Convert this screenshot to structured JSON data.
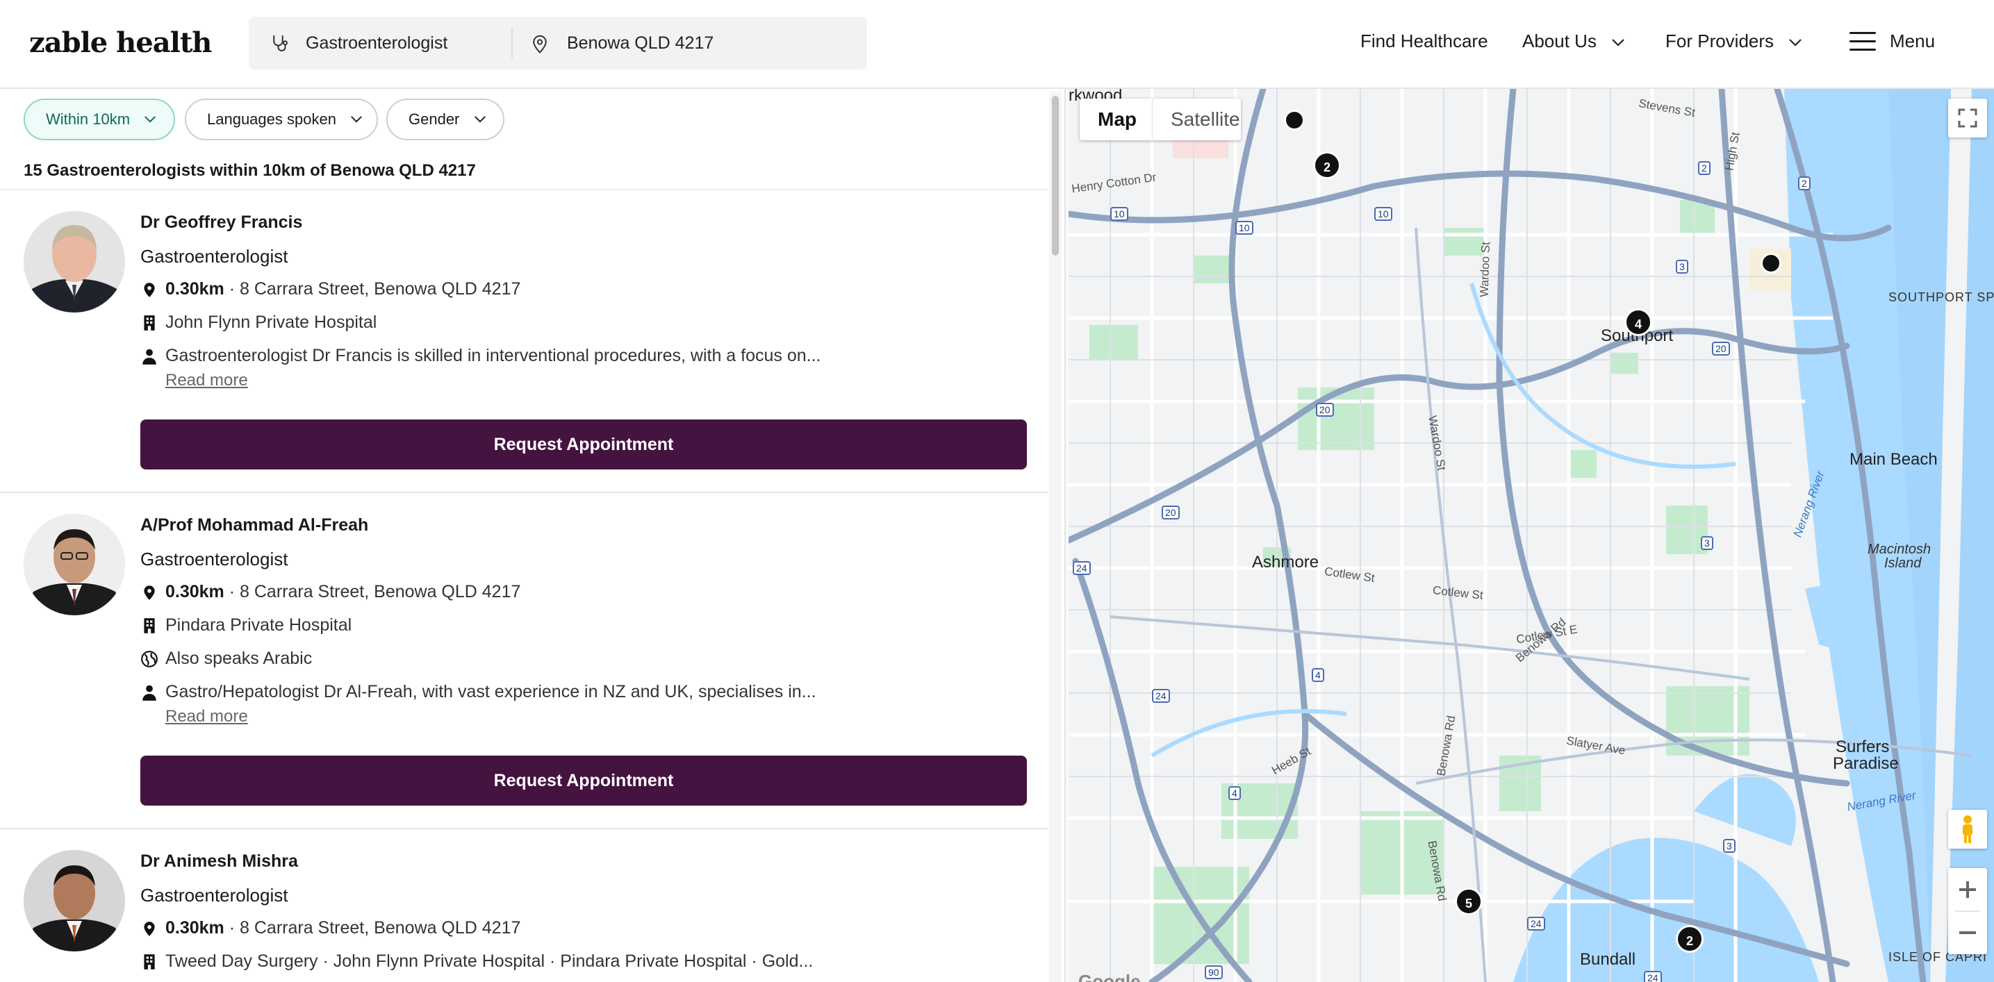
{
  "header": {
    "logo": "zable health",
    "search": {
      "specialty": "Gastroenterologist",
      "location": "Benowa QLD 4217"
    },
    "nav": {
      "find": "Find Healthcare",
      "about": "About Us",
      "providers": "For Providers",
      "menu": "Menu"
    }
  },
  "filters": [
    "Within 10km",
    "Languages spoken",
    "Gender"
  ],
  "results_count": "15 Gastroenterologists within 10km of Benowa QLD 4217",
  "doctors": [
    {
      "name": "Dr Geoffrey Francis",
      "specialty": "Gastroenterologist",
      "distance": "0.30km",
      "address": " · 8 Carrara Street, Benowa QLD 4217",
      "hospital": "John Flynn Private Hospital",
      "bio": "Gastroenterologist Dr Francis is skilled in interventional procedures, with a focus on...",
      "read_more": "Read more",
      "button": "Request Appointment"
    },
    {
      "name": "A/Prof Mohammad Al-Freah",
      "specialty": "Gastroenterologist",
      "distance": "0.30km",
      "address": " · 8 Carrara Street, Benowa QLD 4217",
      "hospital": "Pindara Private Hospital",
      "languages": "Also speaks Arabic",
      "bio": "Gastro/Hepatologist Dr Al-Freah, with vast experience in NZ and UK, specialises in...",
      "read_more": "Read more",
      "button": "Request Appointment"
    },
    {
      "name": "Dr Animesh Mishra",
      "specialty": "Gastroenterologist",
      "distance": "0.30km",
      "address": " · 8 Carrara Street, Benowa QLD 4217",
      "hospital": "Tweed Day Surgery · John Flynn Private Hospital · Pindara Private Hospital · Gold..."
    }
  ],
  "map": {
    "toggle": {
      "map": "Map",
      "satellite": "Satellite"
    },
    "labels": {
      "arkwood": "rkwood",
      "southport_sp": "SOUTHPORT SP",
      "southport": "Southport",
      "main_beach": "Main Beach",
      "ashmore": "Ashmore",
      "macintosh": "Macintosh",
      "island": "Island",
      "surfers": "Surfers",
      "paradise": "Paradise",
      "bundall": "Bundall",
      "isle_of_capri": "ISLE OF CAPRI",
      "stevens_st": "Stevens St",
      "high_st": "High St",
      "wardoo_st": "Wardoo St",
      "wardoo_st2": "Wardoo St",
      "cotlew_st": "Cotlew St",
      "cotlew_st2": "Cotlew St",
      "cotlew_st_e": "Cotlew St E",
      "benowa_rd": "Benowa Rd",
      "benowa_rd2": "Benowa Rd",
      "benowa_rd3": "Benowa Rd",
      "slatyer_ave": "Slatyer Ave",
      "heeb_st": "Heeb St",
      "nerang_river": "Nerang River",
      "nerang_river2": "Nerang River",
      "henry_cotton": "Henry Cotton Dr",
      "google": "Google"
    },
    "markers": [
      "2",
      "4",
      "5",
      "2"
    ],
    "route_shields": [
      "10",
      "10",
      "10",
      "3",
      "2",
      "2",
      "20",
      "20",
      "20",
      "24",
      "24",
      "24",
      "4",
      "4",
      "3",
      "3",
      "90",
      "24"
    ]
  }
}
